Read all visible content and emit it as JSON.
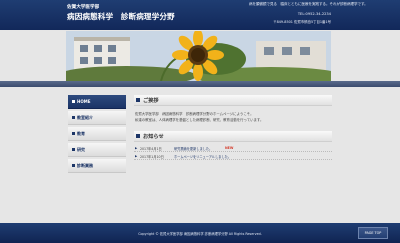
{
  "header": {
    "university": "佐賀大学医学部",
    "department": "病因病態科学　診断病理学分野",
    "slogan": "病を顕微鏡で見る　臨床とともに医療を実践する。それが診断病理学です。",
    "tel": "TEL:0952-34-2234",
    "address": "〒849-8501 佐賀市鍋島5丁目1番1号"
  },
  "sidebar": {
    "items": [
      {
        "label": "HOME",
        "active": true
      },
      {
        "label": "教室紹介",
        "active": false
      },
      {
        "label": "教育",
        "active": false
      },
      {
        "label": "研究",
        "active": false
      },
      {
        "label": "診断業務",
        "active": false
      }
    ]
  },
  "main": {
    "greeting": {
      "heading": "ご挨拶",
      "lines": [
        "佐賀大学医学部　病因病態科学　診断病理学分野のホームページにようこそ。",
        "私達の教室は、人体病理学を基盤とした病理診断、研究、教育活動を行っています。"
      ]
    },
    "news": {
      "heading": "お知らせ",
      "items": [
        {
          "date": "2017年4月1日",
          "title": "研究業績を更新しました。",
          "badge": "NEW"
        },
        {
          "date": "2017年1月10日",
          "title": "ホームページをリニューアルしました。",
          "badge": ""
        }
      ]
    }
  },
  "footer": {
    "copyright": "Copyright © 佐賀大学医学部 病因病態科学 診断病理学分野 All Rights Reserved.",
    "page_top_label": "PAGE TOP"
  },
  "colors": {
    "navy": "#1c3567",
    "background": "#e6e6e6",
    "new_badge": "#d43a2a"
  }
}
